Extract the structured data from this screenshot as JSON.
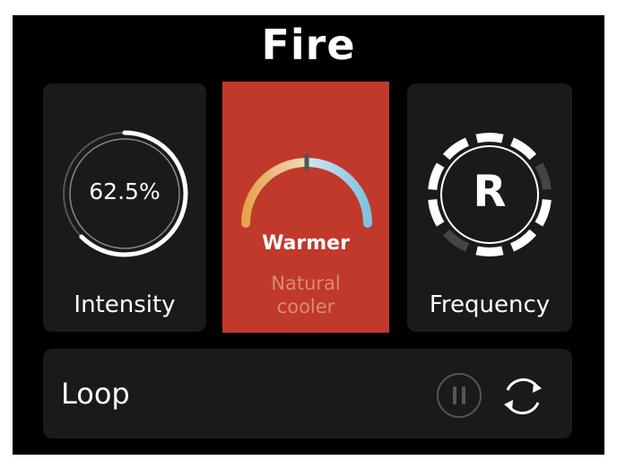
{
  "header": {
    "title": "Fire"
  },
  "cards": {
    "intensity": {
      "value_text": "62.5%",
      "value": 62.5,
      "label": "Intensity"
    },
    "temperature": {
      "selected": "Warmer",
      "options": [
        "Natural",
        "cooler"
      ],
      "background": "#c0392b",
      "gauge_warm": "#e8a24a",
      "gauge_cool": "#7fc3e0",
      "gauge_position": 0.5
    },
    "frequency": {
      "value_text": "R",
      "label": "Frequency"
    }
  },
  "loop": {
    "label": "Loop",
    "pause_icon": "pause-icon",
    "loop_icon": "repeat-icon"
  },
  "colors": {
    "screen": "#000000",
    "card": "#1a1a1a",
    "text": "#ffffff"
  }
}
